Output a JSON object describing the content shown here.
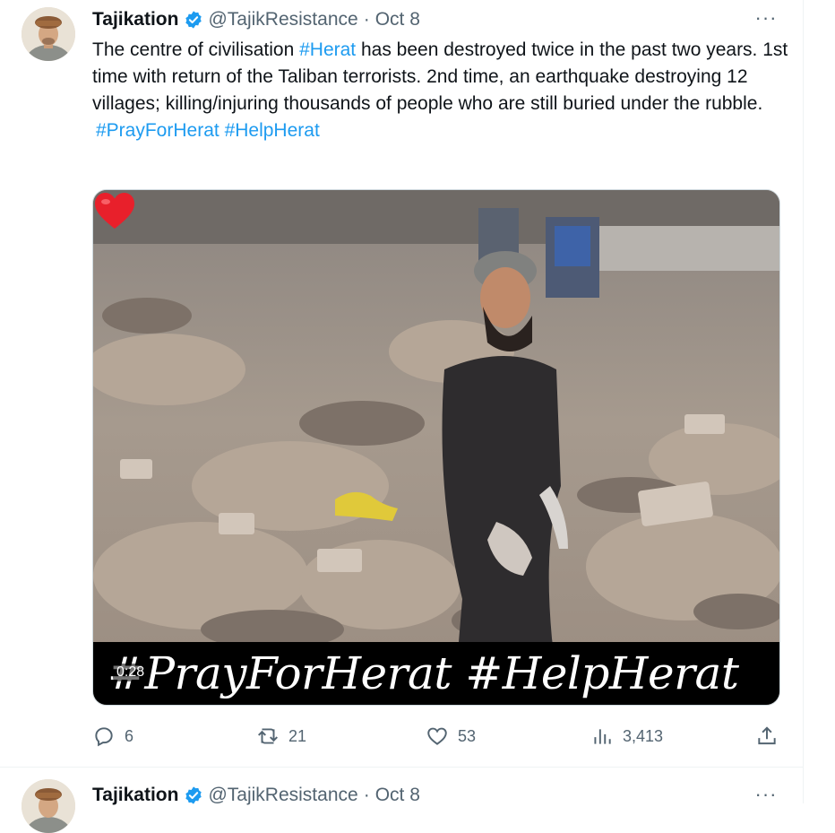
{
  "tweets": [
    {
      "author_name": "Tajikation",
      "handle": "@TajikResistance",
      "separator": "·",
      "date": "Oct 8",
      "more": "···",
      "text": {
        "part1": "The centre of civilisation ",
        "hashtag1": "#Herat",
        "part2": " has been destroyed twice in the past two years. 1st time with return of the Taliban terrorists. 2nd time, an earthquake destroying 12 villages; killing/injuring thousands of people who are still buried under the rubble.",
        "hashtag2": "#PrayForHerat",
        "hashtag3": "#HelpHerat"
      },
      "media": {
        "caption": "#PrayForHerat #HelpHerat",
        "duration": "0:28"
      },
      "actions": {
        "replies": "6",
        "retweets": "21",
        "likes": "53",
        "views": "3,413"
      }
    },
    {
      "author_name": "Tajikation",
      "handle": "@TajikResistance",
      "separator": "·",
      "date": "Oct 8",
      "more": "···"
    }
  ],
  "colors": {
    "accent": "#1d9bf0",
    "text": "#0f1419",
    "muted": "#536471",
    "border": "#eff3f4"
  }
}
